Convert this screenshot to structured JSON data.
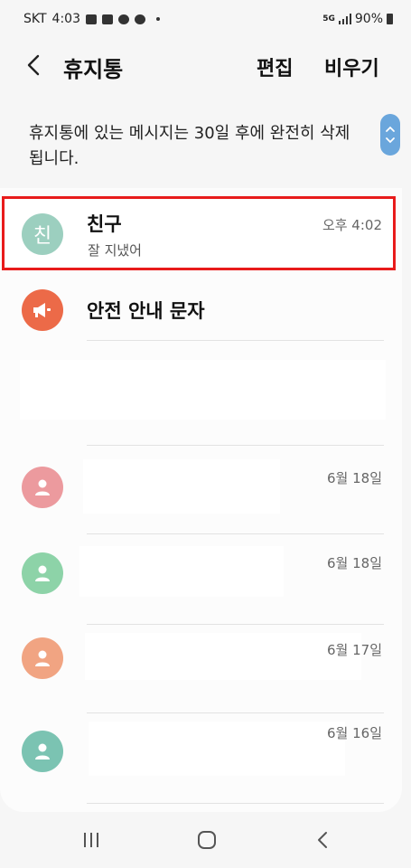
{
  "status_bar": {
    "carrier": "SKT",
    "time": "4:03",
    "network": "5G",
    "battery": "90%"
  },
  "header": {
    "title": "휴지통",
    "edit_label": "편집",
    "empty_label": "비우기"
  },
  "notice": {
    "text": "휴지통에 있는 메시지는 30일 후에 완전히 삭제됩니다."
  },
  "conversations": [
    {
      "avatar_text": "친",
      "name": "친구",
      "preview": "잘 지냈어",
      "time": "오후 4:02",
      "avatar_color": "#9ccfbf",
      "highlighted": true
    },
    {
      "avatar_icon": "megaphone-icon",
      "name": "안전 안내 문자",
      "avatar_color": "#ec6a48"
    },
    {
      "avatar_icon": "person-icon",
      "time": "6월 18일",
      "avatar_color": "#ec9a9e"
    },
    {
      "avatar_icon": "person-icon",
      "time": "6월 18일",
      "avatar_color": "#8dd3a8"
    },
    {
      "avatar_icon": "person-icon",
      "time": "6월 17일",
      "avatar_color": "#f1a482"
    },
    {
      "avatar_icon": "person-icon",
      "time": "6월 16일",
      "avatar_color": "#7bc3b2"
    }
  ],
  "colors": {
    "highlight": "#e81b1b",
    "accent": "#6aa6dc"
  }
}
